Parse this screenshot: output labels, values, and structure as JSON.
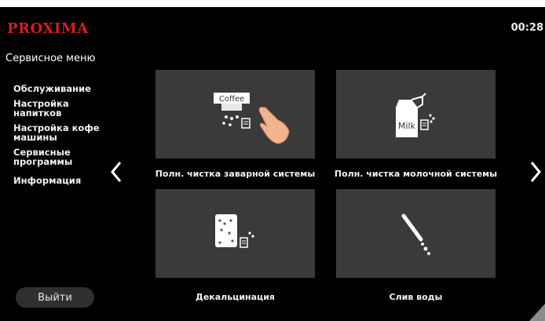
{
  "header": {
    "brand": "PROXIMA",
    "time": "00:28"
  },
  "sidebar": {
    "title": "Сервисное меню",
    "items": [
      {
        "label": "Обслуживание"
      },
      {
        "label": "Настройка напитков"
      },
      {
        "label": "Настройка кофе машины"
      },
      {
        "label": "Сервисные программы"
      },
      {
        "label": "Информация"
      }
    ],
    "exit_label": "Выйти"
  },
  "tiles": [
    {
      "label": "Полн. чистка заварной системы",
      "icon": "coffee-cleaning-icon",
      "icon_text": "Coffee"
    },
    {
      "label": "Полн. чистка молочной системы",
      "icon": "milk-cleaning-icon",
      "icon_text": "Milk"
    },
    {
      "label": "Декальцинация",
      "icon": "descaling-icon"
    },
    {
      "label": "Слив воды",
      "icon": "water-drain-icon"
    }
  ],
  "colors": {
    "brand": "#d21f1f",
    "background": "#000000",
    "tile": "#3a3a3a"
  }
}
